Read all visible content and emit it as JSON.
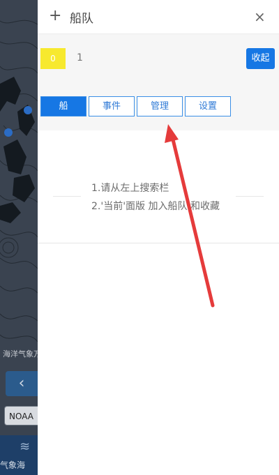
{
  "map": {
    "label": "海洋气象万",
    "prev_icon": "chevron-left-icon",
    "source": "NOAA",
    "bottom_label": "气象海",
    "bottom_icon": "wind-icon"
  },
  "header": {
    "add_icon": "+",
    "title": "船队",
    "close_icon": "×"
  },
  "fleet": {
    "badge_value": "0",
    "count": "1",
    "collapse_label": "收起",
    "badge_color": "#f7e92e"
  },
  "tabs": [
    {
      "label": "船",
      "active": true
    },
    {
      "label": "事件",
      "active": false
    },
    {
      "label": "管理",
      "active": false
    },
    {
      "label": "设置",
      "active": false
    }
  ],
  "empty_state": {
    "line1": "1.请从左上搜索栏",
    "line2": "2.'当前'面版 加入船队 和收藏"
  },
  "colors": {
    "accent": "#1677e4",
    "arrow": "#e53b3b"
  }
}
